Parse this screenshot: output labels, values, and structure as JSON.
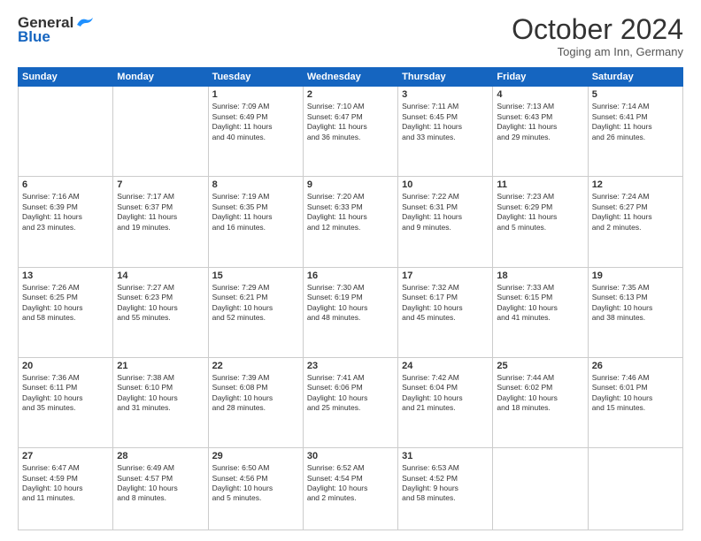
{
  "header": {
    "logo_general": "General",
    "logo_blue": "Blue",
    "month": "October 2024",
    "location": "Toging am Inn, Germany"
  },
  "days_of_week": [
    "Sunday",
    "Monday",
    "Tuesday",
    "Wednesday",
    "Thursday",
    "Friday",
    "Saturday"
  ],
  "weeks": [
    [
      {
        "day": "",
        "content": ""
      },
      {
        "day": "",
        "content": ""
      },
      {
        "day": "1",
        "content": "Sunrise: 7:09 AM\nSunset: 6:49 PM\nDaylight: 11 hours\nand 40 minutes."
      },
      {
        "day": "2",
        "content": "Sunrise: 7:10 AM\nSunset: 6:47 PM\nDaylight: 11 hours\nand 36 minutes."
      },
      {
        "day": "3",
        "content": "Sunrise: 7:11 AM\nSunset: 6:45 PM\nDaylight: 11 hours\nand 33 minutes."
      },
      {
        "day": "4",
        "content": "Sunrise: 7:13 AM\nSunset: 6:43 PM\nDaylight: 11 hours\nand 29 minutes."
      },
      {
        "day": "5",
        "content": "Sunrise: 7:14 AM\nSunset: 6:41 PM\nDaylight: 11 hours\nand 26 minutes."
      }
    ],
    [
      {
        "day": "6",
        "content": "Sunrise: 7:16 AM\nSunset: 6:39 PM\nDaylight: 11 hours\nand 23 minutes."
      },
      {
        "day": "7",
        "content": "Sunrise: 7:17 AM\nSunset: 6:37 PM\nDaylight: 11 hours\nand 19 minutes."
      },
      {
        "day": "8",
        "content": "Sunrise: 7:19 AM\nSunset: 6:35 PM\nDaylight: 11 hours\nand 16 minutes."
      },
      {
        "day": "9",
        "content": "Sunrise: 7:20 AM\nSunset: 6:33 PM\nDaylight: 11 hours\nand 12 minutes."
      },
      {
        "day": "10",
        "content": "Sunrise: 7:22 AM\nSunset: 6:31 PM\nDaylight: 11 hours\nand 9 minutes."
      },
      {
        "day": "11",
        "content": "Sunrise: 7:23 AM\nSunset: 6:29 PM\nDaylight: 11 hours\nand 5 minutes."
      },
      {
        "day": "12",
        "content": "Sunrise: 7:24 AM\nSunset: 6:27 PM\nDaylight: 11 hours\nand 2 minutes."
      }
    ],
    [
      {
        "day": "13",
        "content": "Sunrise: 7:26 AM\nSunset: 6:25 PM\nDaylight: 10 hours\nand 58 minutes."
      },
      {
        "day": "14",
        "content": "Sunrise: 7:27 AM\nSunset: 6:23 PM\nDaylight: 10 hours\nand 55 minutes."
      },
      {
        "day": "15",
        "content": "Sunrise: 7:29 AM\nSunset: 6:21 PM\nDaylight: 10 hours\nand 52 minutes."
      },
      {
        "day": "16",
        "content": "Sunrise: 7:30 AM\nSunset: 6:19 PM\nDaylight: 10 hours\nand 48 minutes."
      },
      {
        "day": "17",
        "content": "Sunrise: 7:32 AM\nSunset: 6:17 PM\nDaylight: 10 hours\nand 45 minutes."
      },
      {
        "day": "18",
        "content": "Sunrise: 7:33 AM\nSunset: 6:15 PM\nDaylight: 10 hours\nand 41 minutes."
      },
      {
        "day": "19",
        "content": "Sunrise: 7:35 AM\nSunset: 6:13 PM\nDaylight: 10 hours\nand 38 minutes."
      }
    ],
    [
      {
        "day": "20",
        "content": "Sunrise: 7:36 AM\nSunset: 6:11 PM\nDaylight: 10 hours\nand 35 minutes."
      },
      {
        "day": "21",
        "content": "Sunrise: 7:38 AM\nSunset: 6:10 PM\nDaylight: 10 hours\nand 31 minutes."
      },
      {
        "day": "22",
        "content": "Sunrise: 7:39 AM\nSunset: 6:08 PM\nDaylight: 10 hours\nand 28 minutes."
      },
      {
        "day": "23",
        "content": "Sunrise: 7:41 AM\nSunset: 6:06 PM\nDaylight: 10 hours\nand 25 minutes."
      },
      {
        "day": "24",
        "content": "Sunrise: 7:42 AM\nSunset: 6:04 PM\nDaylight: 10 hours\nand 21 minutes."
      },
      {
        "day": "25",
        "content": "Sunrise: 7:44 AM\nSunset: 6:02 PM\nDaylight: 10 hours\nand 18 minutes."
      },
      {
        "day": "26",
        "content": "Sunrise: 7:46 AM\nSunset: 6:01 PM\nDaylight: 10 hours\nand 15 minutes."
      }
    ],
    [
      {
        "day": "27",
        "content": "Sunrise: 6:47 AM\nSunset: 4:59 PM\nDaylight: 10 hours\nand 11 minutes."
      },
      {
        "day": "28",
        "content": "Sunrise: 6:49 AM\nSunset: 4:57 PM\nDaylight: 10 hours\nand 8 minutes."
      },
      {
        "day": "29",
        "content": "Sunrise: 6:50 AM\nSunset: 4:56 PM\nDaylight: 10 hours\nand 5 minutes."
      },
      {
        "day": "30",
        "content": "Sunrise: 6:52 AM\nSunset: 4:54 PM\nDaylight: 10 hours\nand 2 minutes."
      },
      {
        "day": "31",
        "content": "Sunrise: 6:53 AM\nSunset: 4:52 PM\nDaylight: 9 hours\nand 58 minutes."
      },
      {
        "day": "",
        "content": ""
      },
      {
        "day": "",
        "content": ""
      }
    ]
  ]
}
